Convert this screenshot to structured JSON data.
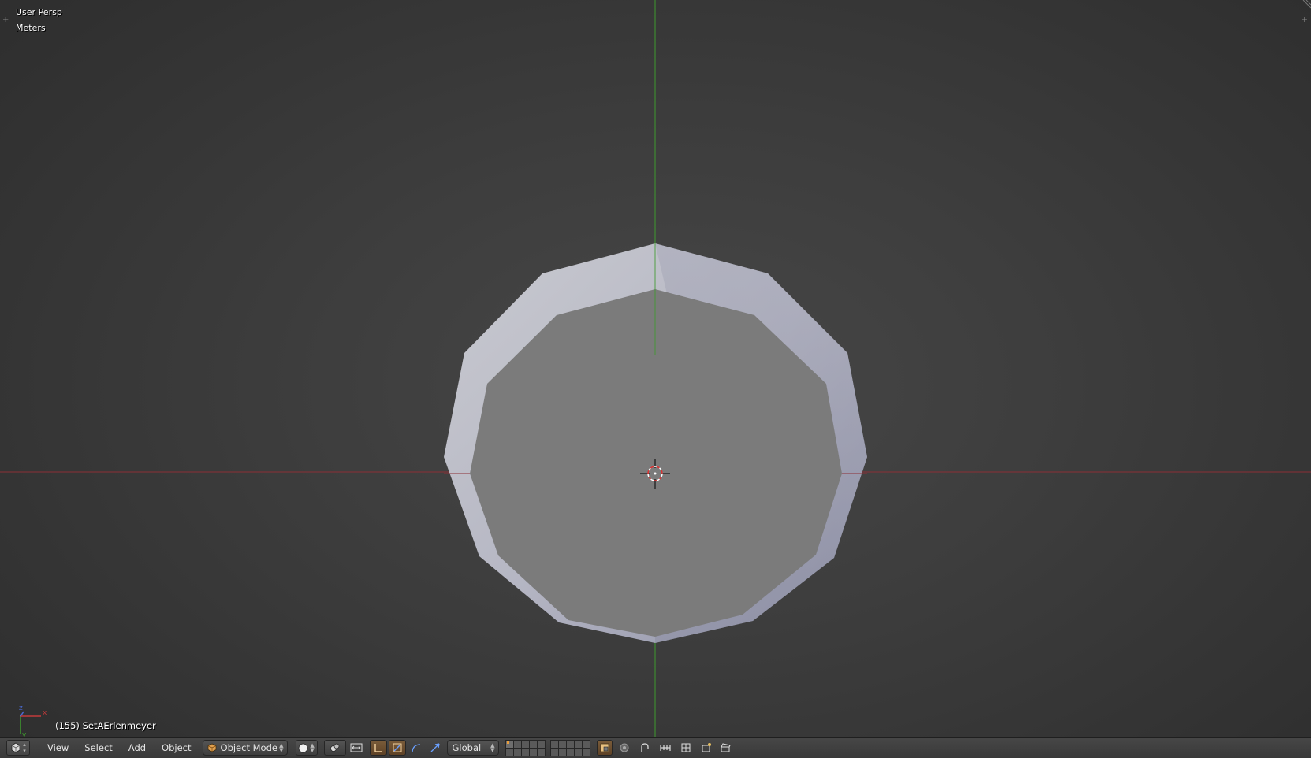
{
  "viewport": {
    "view_name": "User Persp",
    "units": "Meters",
    "object_info": "(155) SetAErlenmeyer",
    "gizmo_axes": [
      "x",
      "y",
      "z"
    ],
    "colors": {
      "background": "#3a3a3a",
      "x_axis": "#8c2f36",
      "y_axis": "#3e9a2e",
      "mesh_rim": "#b9bbc9",
      "mesh_inner": "#7a7a7a"
    }
  },
  "header": {
    "editor_type_icon": "3d-view-icon",
    "menus": [
      {
        "label": "View"
      },
      {
        "label": "Select"
      },
      {
        "label": "Add"
      },
      {
        "label": "Object"
      }
    ],
    "mode": {
      "label": "Object Mode",
      "icon": "cube-icon"
    },
    "shading_icon": "solid-sphere-icon",
    "pivot_icon": "pivot-icon",
    "transform_orientation": "Global",
    "manipulator_icons": [
      "manipulator-icon",
      "translate-icon",
      "rotate-icon",
      "scale-icon"
    ],
    "layers_active": [
      0
    ],
    "extra_icons": [
      "lock-layers-icon",
      "proportional-edit-icon",
      "snap-icon",
      "snap-target-icon",
      "render-icon",
      "opengl-render-icon",
      "clapper-icon"
    ]
  }
}
